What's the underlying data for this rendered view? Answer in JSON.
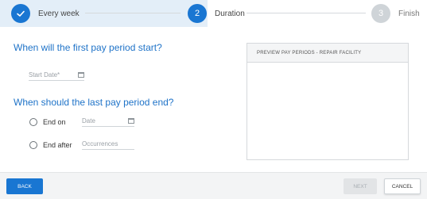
{
  "stepper": {
    "steps": [
      {
        "number": "",
        "label": "Every week",
        "state": "done"
      },
      {
        "number": "2",
        "label": "Duration",
        "state": "current"
      },
      {
        "number": "3",
        "label": "Finish",
        "state": "upcoming"
      }
    ],
    "check_icon": "checkmark-icon"
  },
  "first_period": {
    "heading": "When will the first pay period start?",
    "start_date_placeholder": "Start Date*",
    "calendar_icon": "calendar-icon"
  },
  "last_period": {
    "heading": "When should the last pay period end?",
    "end_on_label": "End on",
    "date_placeholder": "Date",
    "end_after_label": "End after",
    "occurrences_placeholder": "Occurrences"
  },
  "preview": {
    "title": "PREVIEW PAY PERIODS - REPAIR FACILITY"
  },
  "footer": {
    "back_label": "BACK",
    "next_label": "NEXT",
    "cancel_label": "CANCEL"
  },
  "colors": {
    "accent": "#1976d2",
    "heading": "#1f73c8",
    "disabled": "#e2e4e6"
  }
}
